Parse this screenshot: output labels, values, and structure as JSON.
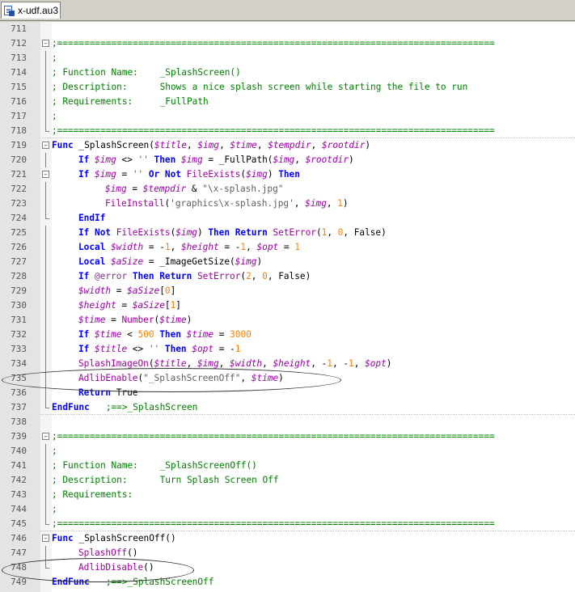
{
  "tab": {
    "filename": "x-udf.au3"
  },
  "lines": [
    {
      "n": "711",
      "fold": "",
      "html": ""
    },
    {
      "n": "712",
      "fold": "box",
      "html": "<span class='c'>;=================================================================================</span>"
    },
    {
      "n": "713",
      "fold": "vline",
      "html": "<span class='c'>;</span>"
    },
    {
      "n": "714",
      "fold": "vline",
      "html": "<span class='c'>; Function Name:    _SplashScreen()</span>"
    },
    {
      "n": "715",
      "fold": "vline",
      "html": "<span class='c'>; Description:      Shows a nice splash screen while starting the file to run</span>"
    },
    {
      "n": "716",
      "fold": "vline",
      "html": "<span class='c'>; Requirements:     _FullPath</span>"
    },
    {
      "n": "717",
      "fold": "vline",
      "html": "<span class='c'>;</span>"
    },
    {
      "n": "718",
      "fold": "end",
      "html": "<span class='c'>;=================================================================================</span>"
    },
    {
      "n": "719",
      "fold": "box",
      "html": "<span class='k'>Func</span> _SplashScreen(<span class='v'>$title</span>, <span class='v'>$img</span>, <span class='v'>$time</span>, <span class='v'>$tempdir</span>, <span class='v'>$rootdir</span>)"
    },
    {
      "n": "720",
      "fold": "vline",
      "html": "<span class='ind1'></span><span class='k'>If</span> <span class='v'>$img</span> &lt;&gt; <span class='s'>''</span> <span class='k'>Then</span> <span class='v'>$img</span> = _FullPath(<span class='v'>$img</span>, <span class='v'>$rootdir</span>)"
    },
    {
      "n": "721",
      "fold": "box",
      "html": "<span class='ind1'></span><span class='k'>If</span> <span class='v'>$img</span> = <span class='s'>''</span> <span class='k'>Or Not</span> <span class='f'>FileExists</span>(<span class='v'>$img</span>) <span class='k'>Then</span>"
    },
    {
      "n": "722",
      "fold": "vline",
      "html": "<span class='ind2'></span><span class='v'>$img</span> = <span class='v'>$tempdir</span> &amp; <span class='s'>\"\\x-splash.jpg\"</span>"
    },
    {
      "n": "723",
      "fold": "vline",
      "html": "<span class='ind2'></span><span class='f'>FileInstall</span>(<span class='s'>'graphics\\x-splash.jpg'</span>, <span class='v'>$img</span>, <span class='n'>1</span>)"
    },
    {
      "n": "724",
      "fold": "end",
      "html": "<span class='ind1'></span><span class='k'>EndIf</span>"
    },
    {
      "n": "725",
      "fold": "vline",
      "html": "<span class='ind1'></span><span class='k'>If Not</span> <span class='f'>FileExists</span>(<span class='v'>$img</span>) <span class='k'>Then Return</span> <span class='f'>SetError</span>(<span class='n'>1</span>, <span class='n'>0</span>, False)"
    },
    {
      "n": "726",
      "fold": "vline",
      "html": "<span class='ind1'></span><span class='k'>Local</span> <span class='v'>$width</span> = -<span class='n'>1</span>, <span class='v'>$height</span> = -<span class='n'>1</span>, <span class='v'>$opt</span> = <span class='n'>1</span>"
    },
    {
      "n": "727",
      "fold": "vline",
      "html": "<span class='ind1'></span><span class='k'>Local</span> <span class='v'>$aSize</span> = _ImageGetSize(<span class='v'>$img</span>)"
    },
    {
      "n": "728",
      "fold": "vline",
      "html": "<span class='ind1'></span><span class='k'>If</span> <span class='m'>@error</span> <span class='k'>Then Return</span> <span class='f'>SetError</span>(<span class='n'>2</span>, <span class='n'>0</span>, False)"
    },
    {
      "n": "729",
      "fold": "vline",
      "html": "<span class='ind1'></span><span class='v'>$width</span> = <span class='v'>$aSize</span>[<span class='n'>0</span>]"
    },
    {
      "n": "730",
      "fold": "vline",
      "html": "<span class='ind1'></span><span class='v'>$height</span> = <span class='v'>$aSize</span>[<span class='n'>1</span>]"
    },
    {
      "n": "731",
      "fold": "vline",
      "html": "<span class='ind1'></span><span class='v'>$time</span> = <span class='f'>Number</span>(<span class='v'>$time</span>)"
    },
    {
      "n": "732",
      "fold": "vline",
      "html": "<span class='ind1'></span><span class='k'>If</span> <span class='v'>$time</span> &lt; <span class='n'>500</span> <span class='k'>Then</span> <span class='v'>$time</span> = <span class='n'>3000</span>"
    },
    {
      "n": "733",
      "fold": "vline",
      "html": "<span class='ind1'></span><span class='k'>If</span> <span class='v'>$title</span> &lt;&gt; <span class='s'>''</span> <span class='k'>Then</span> <span class='v'>$opt</span> = -<span class='n'>1</span>"
    },
    {
      "n": "734",
      "fold": "vline",
      "html": "<span class='ind1'></span><span class='f'>SplashImageOn</span>(<span class='v'>$title</span>, <span class='v'>$img</span>, <span class='v'>$width</span>, <span class='v'>$height</span>, -<span class='n'>1</span>, -<span class='n'>1</span>, <span class='v'>$opt</span>)"
    },
    {
      "n": "735",
      "fold": "vline",
      "html": "<span class='ind1'></span><span class='f'>AdlibEnable</span>(<span class='s'>\"_SplashScreenOff\"</span>, <span class='v'>$time</span>)"
    },
    {
      "n": "736",
      "fold": "vline",
      "html": "<span class='ind1'></span><span class='k'>Return</span> True"
    },
    {
      "n": "737",
      "fold": "end",
      "html": "<span class='k'>EndFunc</span>   <span class='c'>;==&gt;_SplashScreen</span>"
    },
    {
      "n": "738",
      "fold": "",
      "html": ""
    },
    {
      "n": "739",
      "fold": "box",
      "html": "<span class='c'>;=================================================================================</span>"
    },
    {
      "n": "740",
      "fold": "vline",
      "html": "<span class='c'>;</span>"
    },
    {
      "n": "741",
      "fold": "vline",
      "html": "<span class='c'>; Function Name:    _SplashScreenOff()</span>"
    },
    {
      "n": "742",
      "fold": "vline",
      "html": "<span class='c'>; Description:      Turn Splash Screen Off</span>"
    },
    {
      "n": "743",
      "fold": "vline",
      "html": "<span class='c'>; Requirements:</span>"
    },
    {
      "n": "744",
      "fold": "vline",
      "html": "<span class='c'>;</span>"
    },
    {
      "n": "745",
      "fold": "end",
      "html": "<span class='c'>;=================================================================================</span>"
    },
    {
      "n": "746",
      "fold": "box",
      "html": "<span class='k'>Func</span> _SplashScreenOff()"
    },
    {
      "n": "747",
      "fold": "vline",
      "html": "<span class='ind1'></span><span class='f'>SplashOff</span>()"
    },
    {
      "n": "748",
      "fold": "end",
      "html": "<span class='ind1'></span><span class='f'>AdlibDisable</span>()"
    },
    {
      "n": "749",
      "fold": "",
      "html": "<span class='k'>EndFunc</span>   <span class='c'>;==&gt;_SplashScreenOff</span>"
    }
  ],
  "separators_after": [
    "718",
    "737",
    "745"
  ]
}
